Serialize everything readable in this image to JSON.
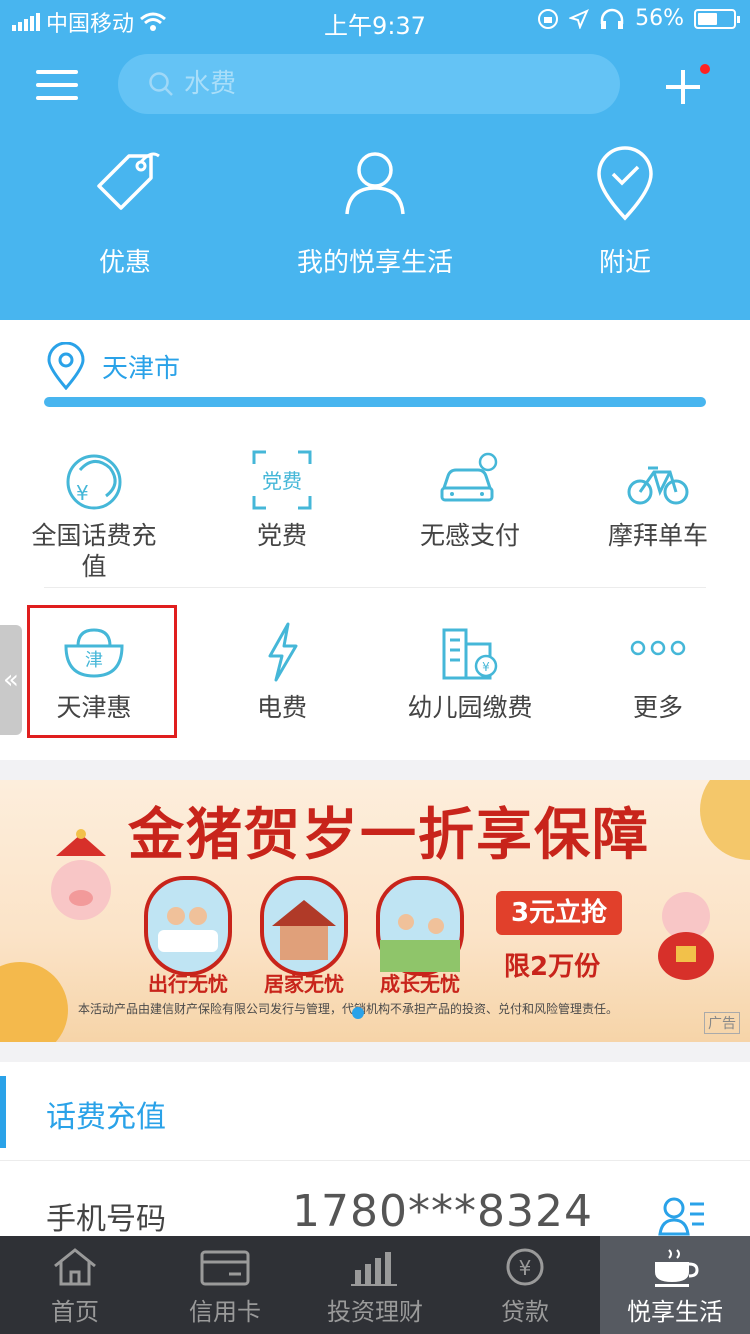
{
  "status_bar": {
    "carrier": "中国移动",
    "time": "上午9:37",
    "battery": "56%",
    "battery_level": 0.56
  },
  "header": {
    "search_placeholder": "水费",
    "entries": [
      {
        "label": "优惠",
        "icon": "tag-icon"
      },
      {
        "label": "我的悦享生活",
        "icon": "user-icon"
      },
      {
        "label": "附近",
        "icon": "location-check-icon"
      }
    ]
  },
  "city": {
    "name": "天津市"
  },
  "services": [
    {
      "label_line1": "全国话费充",
      "label_line2": "值",
      "icon": "phone-credit-icon"
    },
    {
      "label_line1": "党费",
      "label_line2": "",
      "icon": "party-fee-icon",
      "icon_text": "党费"
    },
    {
      "label_line1": "无感支付",
      "label_line2": "",
      "icon": "car-payment-icon"
    },
    {
      "label_line1": "摩拜单车",
      "label_line2": "",
      "icon": "bike-icon"
    },
    {
      "label_line1": "天津惠",
      "label_line2": "",
      "icon": "tianjin-hui-icon",
      "icon_text": "津"
    },
    {
      "label_line1": "电费",
      "label_line2": "",
      "icon": "lightning-icon"
    },
    {
      "label_line1": "幼儿园缴费",
      "label_line2": "",
      "icon": "kindergarten-icon"
    },
    {
      "label_line1": "更多",
      "label_line2": "",
      "icon": "more-dots-icon"
    }
  ],
  "banner": {
    "title": "金猪贺岁一折享保障",
    "shields": [
      "出行无忧",
      "居家无忧",
      "成长无忧"
    ],
    "cta": "3元立抢",
    "limit": "限2万份",
    "disclaimer": "本活动产品由建信财产保险有限公司发行与管理，代销机构不承担产品的投资、兑付和风险管理责任。",
    "ad_tag": "广告"
  },
  "topup": {
    "title": "话费充值",
    "phone_label": "手机号码",
    "phone_number": "1780***8324"
  },
  "tabbar": [
    {
      "label": "首页",
      "icon": "home-icon",
      "active": false
    },
    {
      "label": "信用卡",
      "icon": "credit-card-icon",
      "active": false
    },
    {
      "label": "投资理财",
      "icon": "bar-chart-icon",
      "active": false
    },
    {
      "label": "贷款",
      "icon": "yen-coin-icon",
      "active": false
    },
    {
      "label": "悦享生活",
      "icon": "coffee-cup-icon",
      "active": true
    }
  ],
  "colors": {
    "header_blue": "#48b5ef",
    "accent_blue": "#2aa2e8",
    "highlight_red": "#e01e1e",
    "tabbar": "#2f3136"
  }
}
